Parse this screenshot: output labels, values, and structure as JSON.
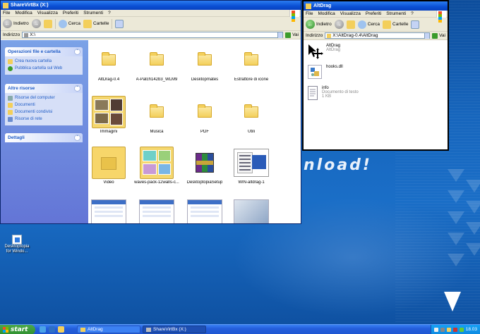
{
  "desktop": {
    "watermark": "nload!",
    "icon_label": "Desktoptopia for Windo..."
  },
  "left_window": {
    "title": "ShareVirtBx (X:)",
    "menu": [
      "File",
      "Modifica",
      "Visualizza",
      "Preferiti",
      "Strumenti",
      "?"
    ],
    "toolbar": {
      "back": "Indietro",
      "search": "Cerca",
      "folders": "Cartelle"
    },
    "address": {
      "label": "Indirizzo",
      "value": "X:\\",
      "go": "Vai"
    },
    "panels": [
      {
        "title": "Operazioni file e cartella",
        "items": [
          "Crea nuova cartella",
          "Pubblica cartella sul Web"
        ]
      },
      {
        "title": "Altre risorse",
        "items": [
          "Risorse del computer",
          "Documenti",
          "Documenti condivisi",
          "Risorse di rete"
        ]
      },
      {
        "title": "Dettagli",
        "items": []
      }
    ],
    "items": [
      "AltDrag-0.4",
      "A-Patch142b3_WLM9",
      "Desktopmates",
      "Estrattore di icone",
      "Immagini",
      "Musica",
      "PDF",
      "Utili",
      "Video",
      "waves-pack-12walls-c...",
      "DesktoptopiaSetup",
      "WIN-altdrag-1",
      "",
      "",
      "",
      ""
    ]
  },
  "right_window": {
    "title": "AltDrag",
    "menu": [
      "File",
      "Modifica",
      "Visualizza",
      "Preferiti",
      "Strumenti",
      "?"
    ],
    "toolbar": {
      "back": "Indietro",
      "search": "Cerca",
      "folders": "Cartelle"
    },
    "address": {
      "label": "Indirizzo",
      "value": "X:\\AltDrag-0.4\\AltDrag",
      "go": "Vai"
    },
    "files": [
      {
        "name": "AltDrag",
        "sub1": "AltDrag",
        "sub2": ""
      },
      {
        "name": "hooks.dll",
        "sub1": "",
        "sub2": ""
      },
      {
        "name": "info",
        "sub1": "Documento di testo",
        "sub2": "1 KB"
      }
    ]
  },
  "taskbar": {
    "start": "start",
    "tasks": [
      "AltDrag",
      "ShareVirtBx (X:)"
    ],
    "clock": "18.03"
  },
  "colors": {
    "titlebar": "#0a4fd3",
    "taskbar": "#245edc",
    "start": "#2f8f2f",
    "folder": "#f3cf5b"
  }
}
